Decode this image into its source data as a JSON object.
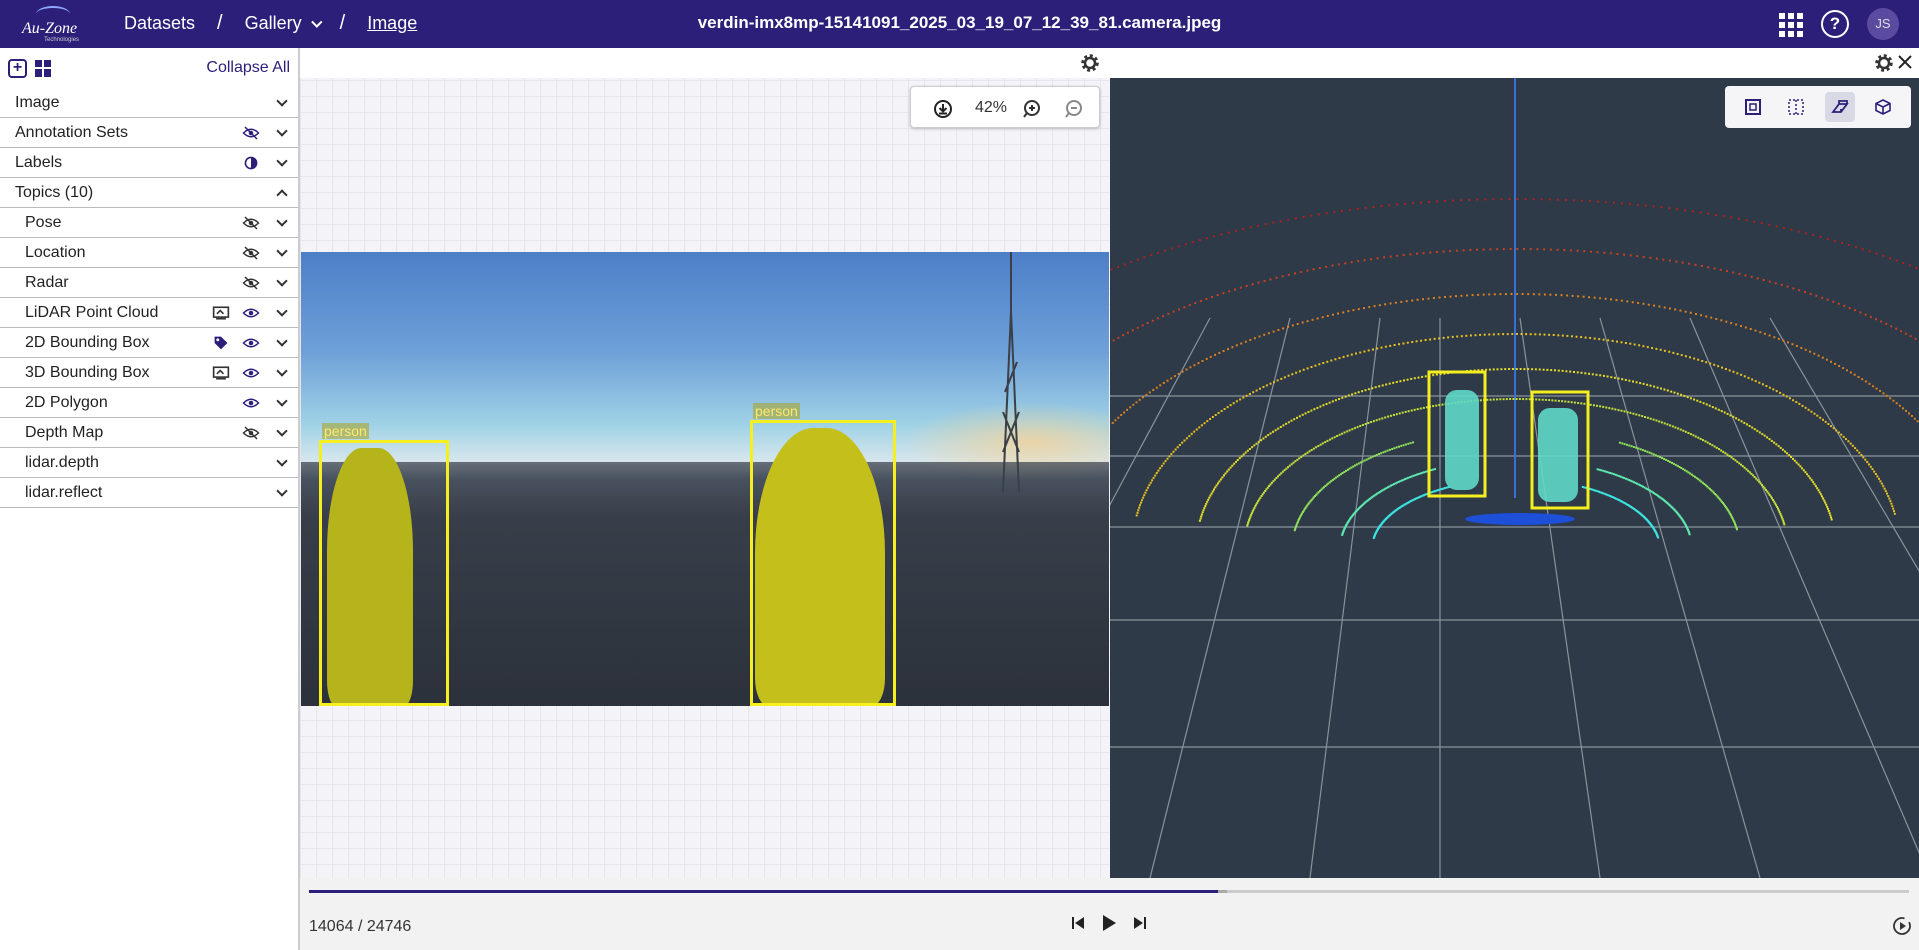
{
  "header": {
    "logo_text": "Au-Zone",
    "logo_sub": "Technologies",
    "breadcrumbs": [
      "Datasets",
      "Gallery",
      "Image"
    ],
    "title": "verdin-imx8mp-15141091_2025_03_19_07_12_39_81.camera.jpeg",
    "avatar_initials": "JS",
    "brand_color": "#2c1f7a"
  },
  "sidebar": {
    "collapse_label": "Collapse All",
    "rows": [
      {
        "label": "Image"
      },
      {
        "label": "Annotation Sets"
      },
      {
        "label": "Labels"
      },
      {
        "label": "Topics (10)"
      },
      {
        "label": "Pose"
      },
      {
        "label": "Location"
      },
      {
        "label": "Radar"
      },
      {
        "label": "LiDAR Point Cloud"
      },
      {
        "label": "2D Bounding Box"
      },
      {
        "label": "3D Bounding Box"
      },
      {
        "label": "2D Polygon"
      },
      {
        "label": "Depth Map"
      },
      {
        "label": "lidar.depth"
      },
      {
        "label": "lidar.reflect"
      }
    ]
  },
  "image_panel": {
    "zoom": "42%",
    "box_labels": [
      "person",
      "person"
    ],
    "box_color": "#f5ef1f"
  },
  "pointcloud_panel": {
    "view_buttons": [
      "top-view-icon",
      "grid-view-icon",
      "perspective-view-icon",
      "cube-view-icon"
    ],
    "selected_view": "perspective-view-icon"
  },
  "playback": {
    "frame_counter": "14064 / 24746",
    "progress_fraction": 0.568
  }
}
